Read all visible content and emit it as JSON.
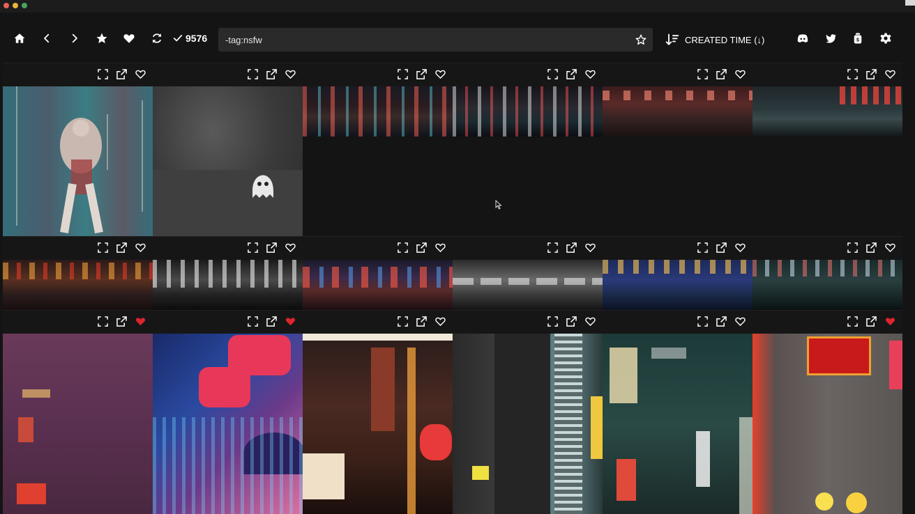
{
  "window": {
    "controls": [
      "close",
      "minimize",
      "maximize"
    ]
  },
  "toolbar": {
    "buttons": [
      {
        "name": "home",
        "icon": "home-icon"
      },
      {
        "name": "back",
        "icon": "chevron-left-icon"
      },
      {
        "name": "forward",
        "icon": "chevron-right-icon"
      },
      {
        "name": "favorites",
        "icon": "star-icon"
      },
      {
        "name": "liked",
        "icon": "heart-icon"
      },
      {
        "name": "refresh",
        "icon": "refresh-icon"
      }
    ],
    "count": "9576",
    "search_value": "-tag:nsfw",
    "sort_label": "CREATED TIME (↓)",
    "right_buttons": [
      {
        "name": "discord",
        "icon": "discord-icon"
      },
      {
        "name": "twitter",
        "icon": "twitter-icon"
      },
      {
        "name": "tip",
        "icon": "tip-jar-icon"
      },
      {
        "name": "settings",
        "icon": "gear-icon"
      }
    ]
  },
  "grid": {
    "cell_actions": [
      "expand-icon",
      "open-external-icon",
      "heart-icon"
    ],
    "rows": [
      {
        "liked": [
          false,
          false,
          false,
          false,
          false,
          false
        ]
      },
      {
        "liked": [
          false,
          false,
          false,
          false,
          false,
          false
        ]
      },
      {
        "liked": [
          true,
          true,
          false,
          false,
          false,
          true
        ]
      }
    ]
  },
  "colors": {
    "background": "#141414",
    "search_bg": "#2a2a2a",
    "liked_heart": "#e0242e"
  }
}
